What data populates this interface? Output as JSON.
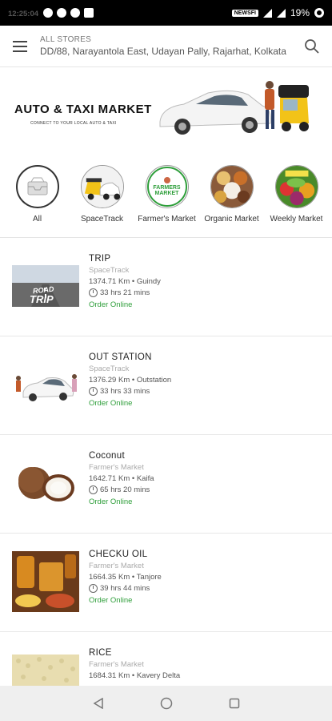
{
  "status_bar": {
    "time": "12:25:04",
    "network": "NEWSFI",
    "battery": "19%"
  },
  "header": {
    "store_label": "ALL STORES",
    "address": "DD/88, Narayantola East, Udayan Pally, Rajarhat, Kolkata"
  },
  "banner": {
    "title": "AUTO & TAXI MARKET",
    "subtitle": "CONNECT TO YOUR LOCAL AUTO & TAXI"
  },
  "categories": [
    {
      "label": "All"
    },
    {
      "label": "SpaceTrack"
    },
    {
      "label": "Farmer's Market",
      "badge_line1": "FARMERS",
      "badge_line2": "MARKET"
    },
    {
      "label": "Organic Market"
    },
    {
      "label": "Weekly Market",
      "badge": "LOCAL MARKET"
    }
  ],
  "items": [
    {
      "name": "TRIP",
      "store": "SpaceTrack",
      "distance": "1374.71 Km • Guindy",
      "time": "33 hrs 21 mins",
      "action": "Order Online",
      "thumb_text_1": "ROAD",
      "thumb_text_2": "TRIP"
    },
    {
      "name": "OUT STATION",
      "store": "SpaceTrack",
      "distance": "1376.29 Km • Outstation",
      "time": "33 hrs 33 mins",
      "action": "Order Online"
    },
    {
      "name": "Coconut",
      "store": "Farmer's Market",
      "distance": "1642.71 Km • Kaifa",
      "time": "65 hrs 20 mins",
      "action": "Order Online"
    },
    {
      "name": "CHECKU OIL",
      "store": "Farmer's Market",
      "distance": "1664.35 Km • Tanjore",
      "time": "39 hrs 44 mins",
      "action": "Order Online"
    },
    {
      "name": "RICE",
      "store": "Farmer's Market",
      "distance": "1684.31 Km • Kavery Delta",
      "time": "",
      "action": ""
    }
  ],
  "colors": {
    "accent_green": "#2e9e3a",
    "status_bar": "#000000",
    "nav_bar": "#efefef"
  },
  "icons": {
    "menu": "hamburger-icon",
    "search": "search-icon",
    "back": "back-triangle-icon",
    "home": "home-circle-icon",
    "recents": "recents-square-icon"
  }
}
